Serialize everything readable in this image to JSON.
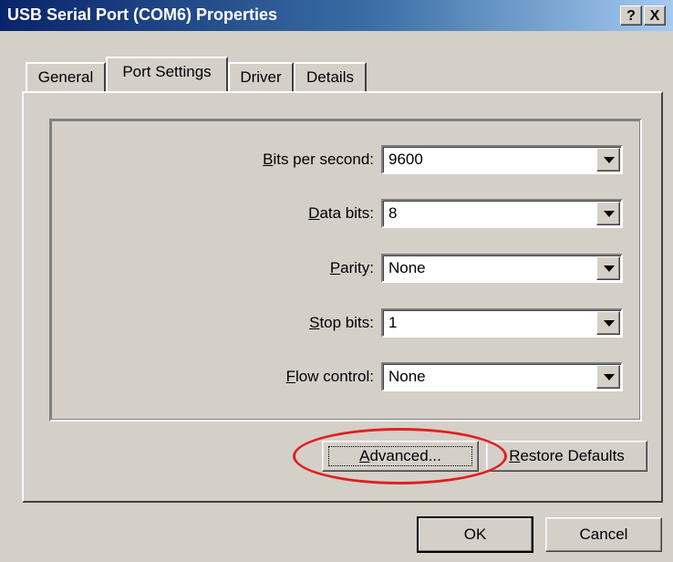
{
  "window": {
    "title": "USB Serial Port (COM6) Properties",
    "help_label": "?",
    "close_label": "X"
  },
  "tabs": [
    {
      "label": "General"
    },
    {
      "label": "Port Settings",
      "active": true
    },
    {
      "label": "Driver"
    },
    {
      "label": "Details"
    }
  ],
  "settings": {
    "bits_per_second": {
      "mnemonic": "B",
      "rest": "its per second:",
      "value": "9600"
    },
    "data_bits": {
      "mnemonic": "D",
      "rest": "ata bits:",
      "value": "8"
    },
    "parity": {
      "mnemonic": "P",
      "rest": "arity:",
      "value": "None"
    },
    "stop_bits": {
      "mnemonic": "S",
      "rest": "top bits:",
      "value": "1"
    },
    "flow_control": {
      "mnemonic": "F",
      "rest": "low control:",
      "value": "None"
    }
  },
  "buttons": {
    "advanced": {
      "mnemonic": "A",
      "rest": "dvanced..."
    },
    "restore": {
      "mnemonic": "R",
      "rest": "estore Defaults"
    },
    "ok": "OK",
    "cancel": "Cancel"
  },
  "annotation": {
    "color": "#e02020",
    "target": "advanced-button"
  },
  "colors": {
    "face": "#d4d0c8",
    "title_start": "#0a246a",
    "title_end": "#a6caf0"
  }
}
